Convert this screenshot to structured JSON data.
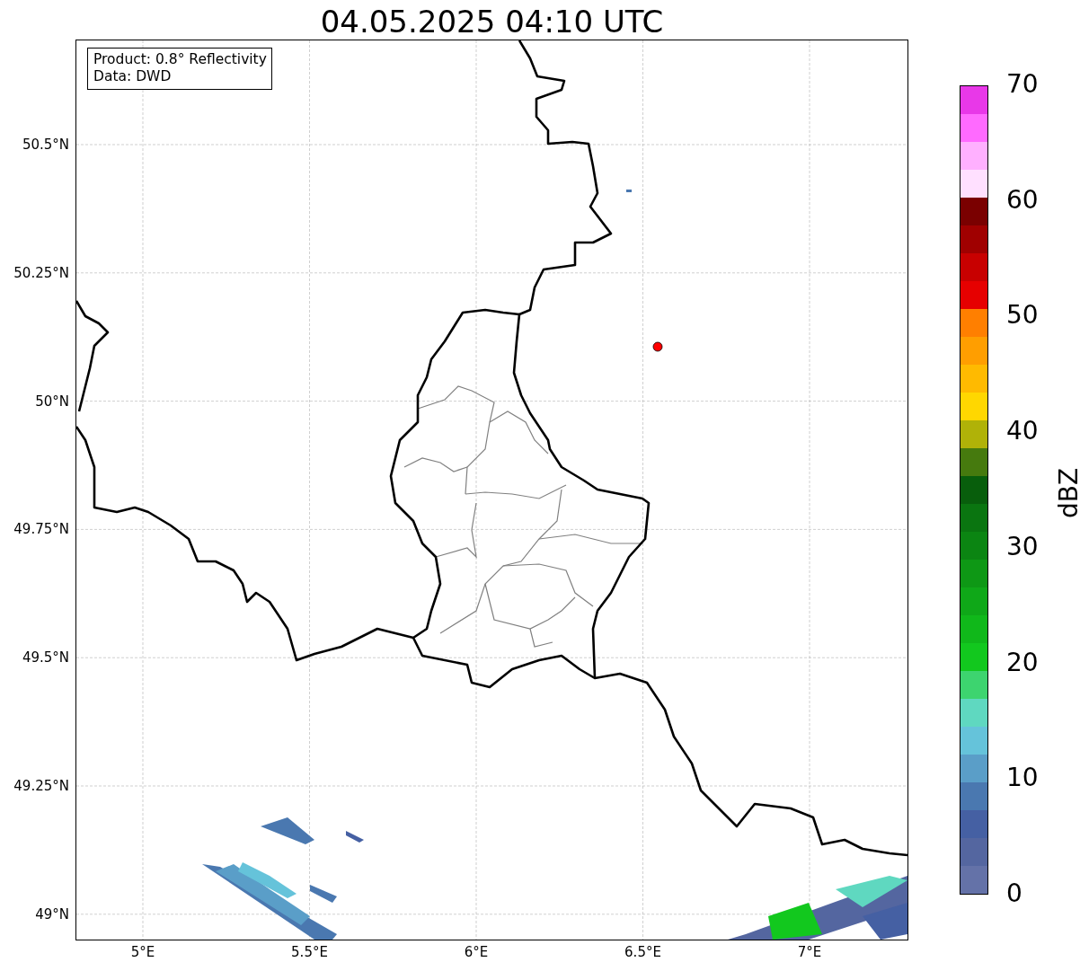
{
  "title": "04.05.2025 04:10 UTC",
  "info_box": [
    "Product: 0.8° Reflectivity",
    "Data: DWD"
  ],
  "lat_ticks": [
    "50.5°N",
    "50.25°N",
    "50°N",
    "49.75°N",
    "49.5°N",
    "49.25°N",
    "49°N"
  ],
  "lon_ticks": [
    "5°E",
    "5.5°E",
    "6°E",
    "6.5°E",
    "7°E"
  ],
  "colorbar": {
    "label": "dBZ",
    "ticks": [
      "70",
      "60",
      "50",
      "40",
      "30",
      "20",
      "10",
      "0"
    ],
    "bins": [
      {
        "color": "#e838e8"
      },
      {
        "color": "#ff6aff"
      },
      {
        "color": "#ffb0ff"
      },
      {
        "color": "#ffe0ff"
      },
      {
        "color": "#7a0000"
      },
      {
        "color": "#a00000"
      },
      {
        "color": "#c80000"
      },
      {
        "color": "#e60000"
      },
      {
        "color": "#ff7f00"
      },
      {
        "color": "#ff9e00"
      },
      {
        "color": "#ffba00"
      },
      {
        "color": "#ffd700"
      },
      {
        "color": "#b0b208"
      },
      {
        "color": "#467a0e"
      },
      {
        "color": "#085e0c"
      },
      {
        "color": "#0a7510"
      },
      {
        "color": "#0b8512"
      },
      {
        "color": "#0e9815"
      },
      {
        "color": "#0fa818"
      },
      {
        "color": "#10b81a"
      },
      {
        "color": "#12c81e"
      },
      {
        "color": "#3dd46f"
      },
      {
        "color": "#5fd8c0"
      },
      {
        "color": "#65c3da"
      },
      {
        "color": "#5a9ec8"
      },
      {
        "color": "#4a78b0"
      },
      {
        "color": "#4560a3"
      },
      {
        "color": "#5466a0"
      },
      {
        "color": "#6472a8"
      }
    ]
  }
}
